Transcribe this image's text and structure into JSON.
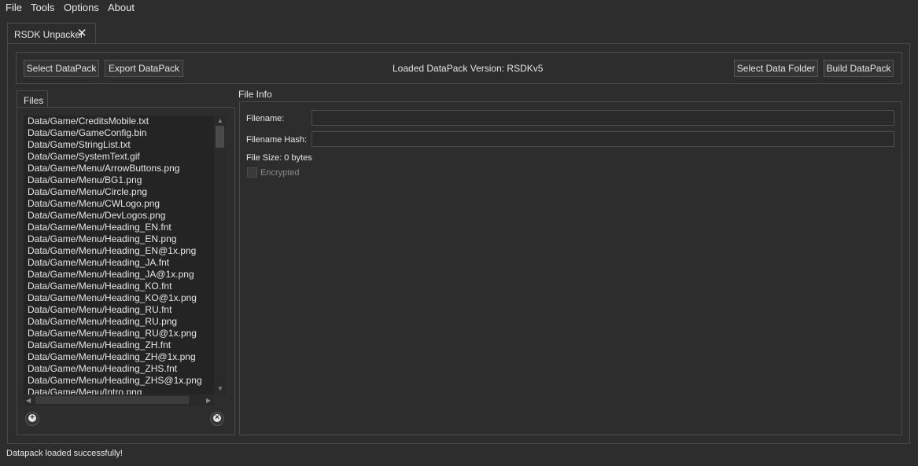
{
  "menu": [
    "File",
    "Tools",
    "Options",
    "About"
  ],
  "tab": {
    "title": "RSDK Unpacker",
    "close": "✕"
  },
  "toolbar": {
    "select_datapack": "Select DataPack",
    "export_datapack": "Export DataPack",
    "version": "Loaded DataPack Version: RSDKv5",
    "select_folder": "Select Data Folder",
    "build_datapack": "Build DataPack"
  },
  "files": {
    "tab_label": "Files",
    "items": [
      "Data/Game/CreditsMobile.txt",
      "Data/Game/GameConfig.bin",
      "Data/Game/StringList.txt",
      "Data/Game/SystemText.gif",
      "Data/Game/Menu/ArrowButtons.png",
      "Data/Game/Menu/BG1.png",
      "Data/Game/Menu/Circle.png",
      "Data/Game/Menu/CWLogo.png",
      "Data/Game/Menu/DevLogos.png",
      "Data/Game/Menu/Heading_EN.fnt",
      "Data/Game/Menu/Heading_EN.png",
      "Data/Game/Menu/Heading_EN@1x.png",
      "Data/Game/Menu/Heading_JA.fnt",
      "Data/Game/Menu/Heading_JA@1x.png",
      "Data/Game/Menu/Heading_KO.fnt",
      "Data/Game/Menu/Heading_KO@1x.png",
      "Data/Game/Menu/Heading_RU.fnt",
      "Data/Game/Menu/Heading_RU.png",
      "Data/Game/Menu/Heading_RU@1x.png",
      "Data/Game/Menu/Heading_ZH.fnt",
      "Data/Game/Menu/Heading_ZH@1x.png",
      "Data/Game/Menu/Heading_ZHS.fnt",
      "Data/Game/Menu/Heading_ZHS@1x.png",
      "Data/Game/Menu/Intro.png"
    ]
  },
  "info": {
    "title": "File Info",
    "filename_label": "Filename:",
    "filename_value": "",
    "hash_label": "Filename Hash:",
    "hash_value": "",
    "size": "File Size: 0 bytes",
    "encrypted_label": "Encrypted"
  },
  "status": "Datapack loaded successfully!"
}
